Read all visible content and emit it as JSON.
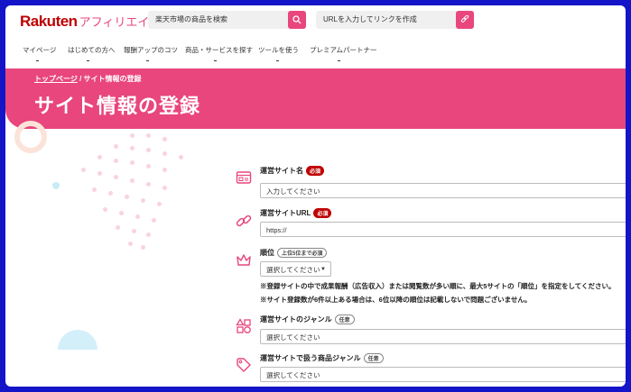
{
  "header": {
    "logo_main": "Rakuten",
    "logo_sub": "アフィリエイト",
    "search": {
      "placeholder": "楽天市場の商品を検索"
    },
    "url_field": {
      "placeholder": "URLを入力してリンクを作成"
    }
  },
  "nav": {
    "items": [
      {
        "label": "マイページ"
      },
      {
        "label": "はじめての方へ"
      },
      {
        "label": "報酬アップのコツ"
      },
      {
        "label": "商品・サービスを探す"
      },
      {
        "label": "ツールを使う"
      },
      {
        "label": "プレミアムパートナー"
      }
    ]
  },
  "banner": {
    "breadcrumb_top": "トップページ",
    "breadcrumb_sep": "/",
    "breadcrumb_current": "サイト情報の登録",
    "title": "サイト情報の登録"
  },
  "form": {
    "site_name": {
      "label": "運営サイト名",
      "badge": "必須",
      "placeholder": "入力してください"
    },
    "site_url": {
      "label": "運営サイトURL",
      "badge": "必須",
      "value": "https://"
    },
    "rank": {
      "label": "順位",
      "badge": "上位5位まで必須",
      "value": "選択してください"
    },
    "notes": [
      "※登録サイトの中で成果報酬（広告収入）または閲覧数が多い順に、最大5サイトの「順位」を指定をしてください。",
      "※サイト登録数が6件以上ある場合は、6位以降の順位は記載しないで問題ございません。"
    ],
    "genre": {
      "label": "運営サイトのジャンル",
      "badge": "任意",
      "value": "選択してください"
    },
    "product_genre": {
      "label": "運営サイトで扱う商品ジャンル",
      "badge": "任意",
      "value": "選択してください"
    }
  },
  "colors": {
    "brand": "#e8467c",
    "required": "#bf0000",
    "frame": "#1414c8"
  }
}
